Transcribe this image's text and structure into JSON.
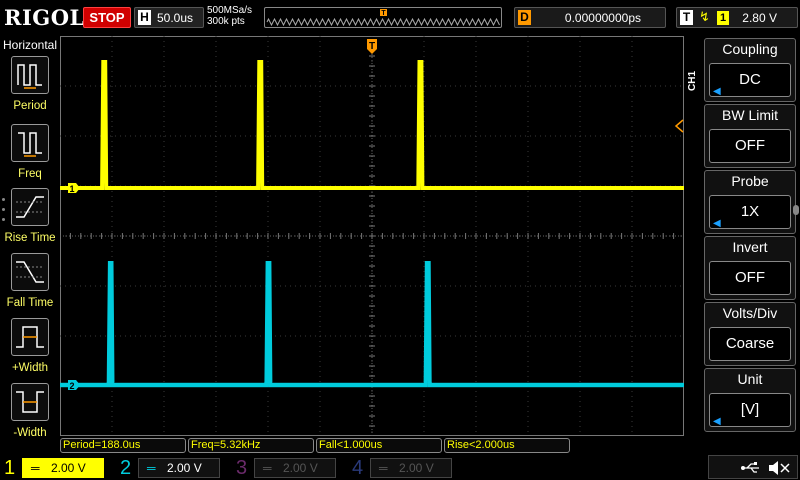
{
  "brand": "RIGOL",
  "run_state": "STOP",
  "horizontal": {
    "tag": "H",
    "timebase": "50.0us"
  },
  "acquisition": {
    "sample_rate": "500MSa/s",
    "memory_depth": "300k pts"
  },
  "delay": {
    "tag": "D",
    "value": "0.00000000ps"
  },
  "trigger": {
    "tag": "T",
    "edge_icon": "rising-edge-icon",
    "source": "1",
    "level": "2.80 V"
  },
  "left_menu": {
    "title": "Horizontal",
    "items": [
      {
        "label": "Period",
        "icon": "period-icon"
      },
      {
        "label": "Freq",
        "icon": "freq-icon"
      },
      {
        "label": "Rise Time",
        "icon": "rise-time-icon"
      },
      {
        "label": "Fall Time",
        "icon": "fall-time-icon"
      },
      {
        "label": "+Width",
        "icon": "plus-width-icon"
      },
      {
        "label": "-Width",
        "icon": "minus-width-icon"
      }
    ]
  },
  "right_menu": {
    "channel_tab": "CH1",
    "items": [
      {
        "title": "Coupling",
        "value": "DC",
        "arrow": true
      },
      {
        "title": "BW Limit",
        "value": "OFF",
        "arrow": false
      },
      {
        "title": "Probe",
        "value": "1X",
        "arrow": true
      },
      {
        "title": "Invert",
        "value": "OFF",
        "arrow": false
      },
      {
        "title": "Volts/Div",
        "value": "Coarse",
        "arrow": false
      },
      {
        "title": "Unit",
        "value": "[V]",
        "arrow": true
      }
    ]
  },
  "measurements": [
    {
      "label": "Period=188.0us"
    },
    {
      "label": "Freq=5.32kHz"
    },
    {
      "label": "Fall<1.000us"
    },
    {
      "label": "Rise<2.000us"
    }
  ],
  "channels": [
    {
      "number": "1",
      "scale": "2.00 V",
      "color": "#ffff00",
      "active": true
    },
    {
      "number": "2",
      "scale": "2.00 V",
      "color": "#00ccdd",
      "active": true
    },
    {
      "number": "3",
      "scale": "2.00 V",
      "color": "#b040b0",
      "active": false
    },
    {
      "number": "4",
      "scale": "2.00 V",
      "color": "#4060c0",
      "active": false
    }
  ],
  "markers": {
    "ch1": "1",
    "ch2": "2",
    "trigger": "T"
  },
  "chart_data": {
    "type": "line",
    "title": "",
    "xlabel": "",
    "ylabel": "",
    "x_unit": "us",
    "series": [
      {
        "name": "",
        "edges_us": [
          [
            40.5,
            43.5
          ],
          [
            190.5,
            193.5
          ],
          [
            344.5,
            347.5
          ]
        ]
      },
      {
        "name": "",
        "edges_us": [
          [
            46.8,
            49.5
          ],
          [
            198.5,
            201.3
          ],
          [
            351.5,
            354.5
          ]
        ]
      }
    ],
    "grid": true
  },
  "colors": {
    "ch1": "#ffff00",
    "ch2": "#00ccdd",
    "accent": "#ff9900",
    "stop": "#d00000"
  }
}
